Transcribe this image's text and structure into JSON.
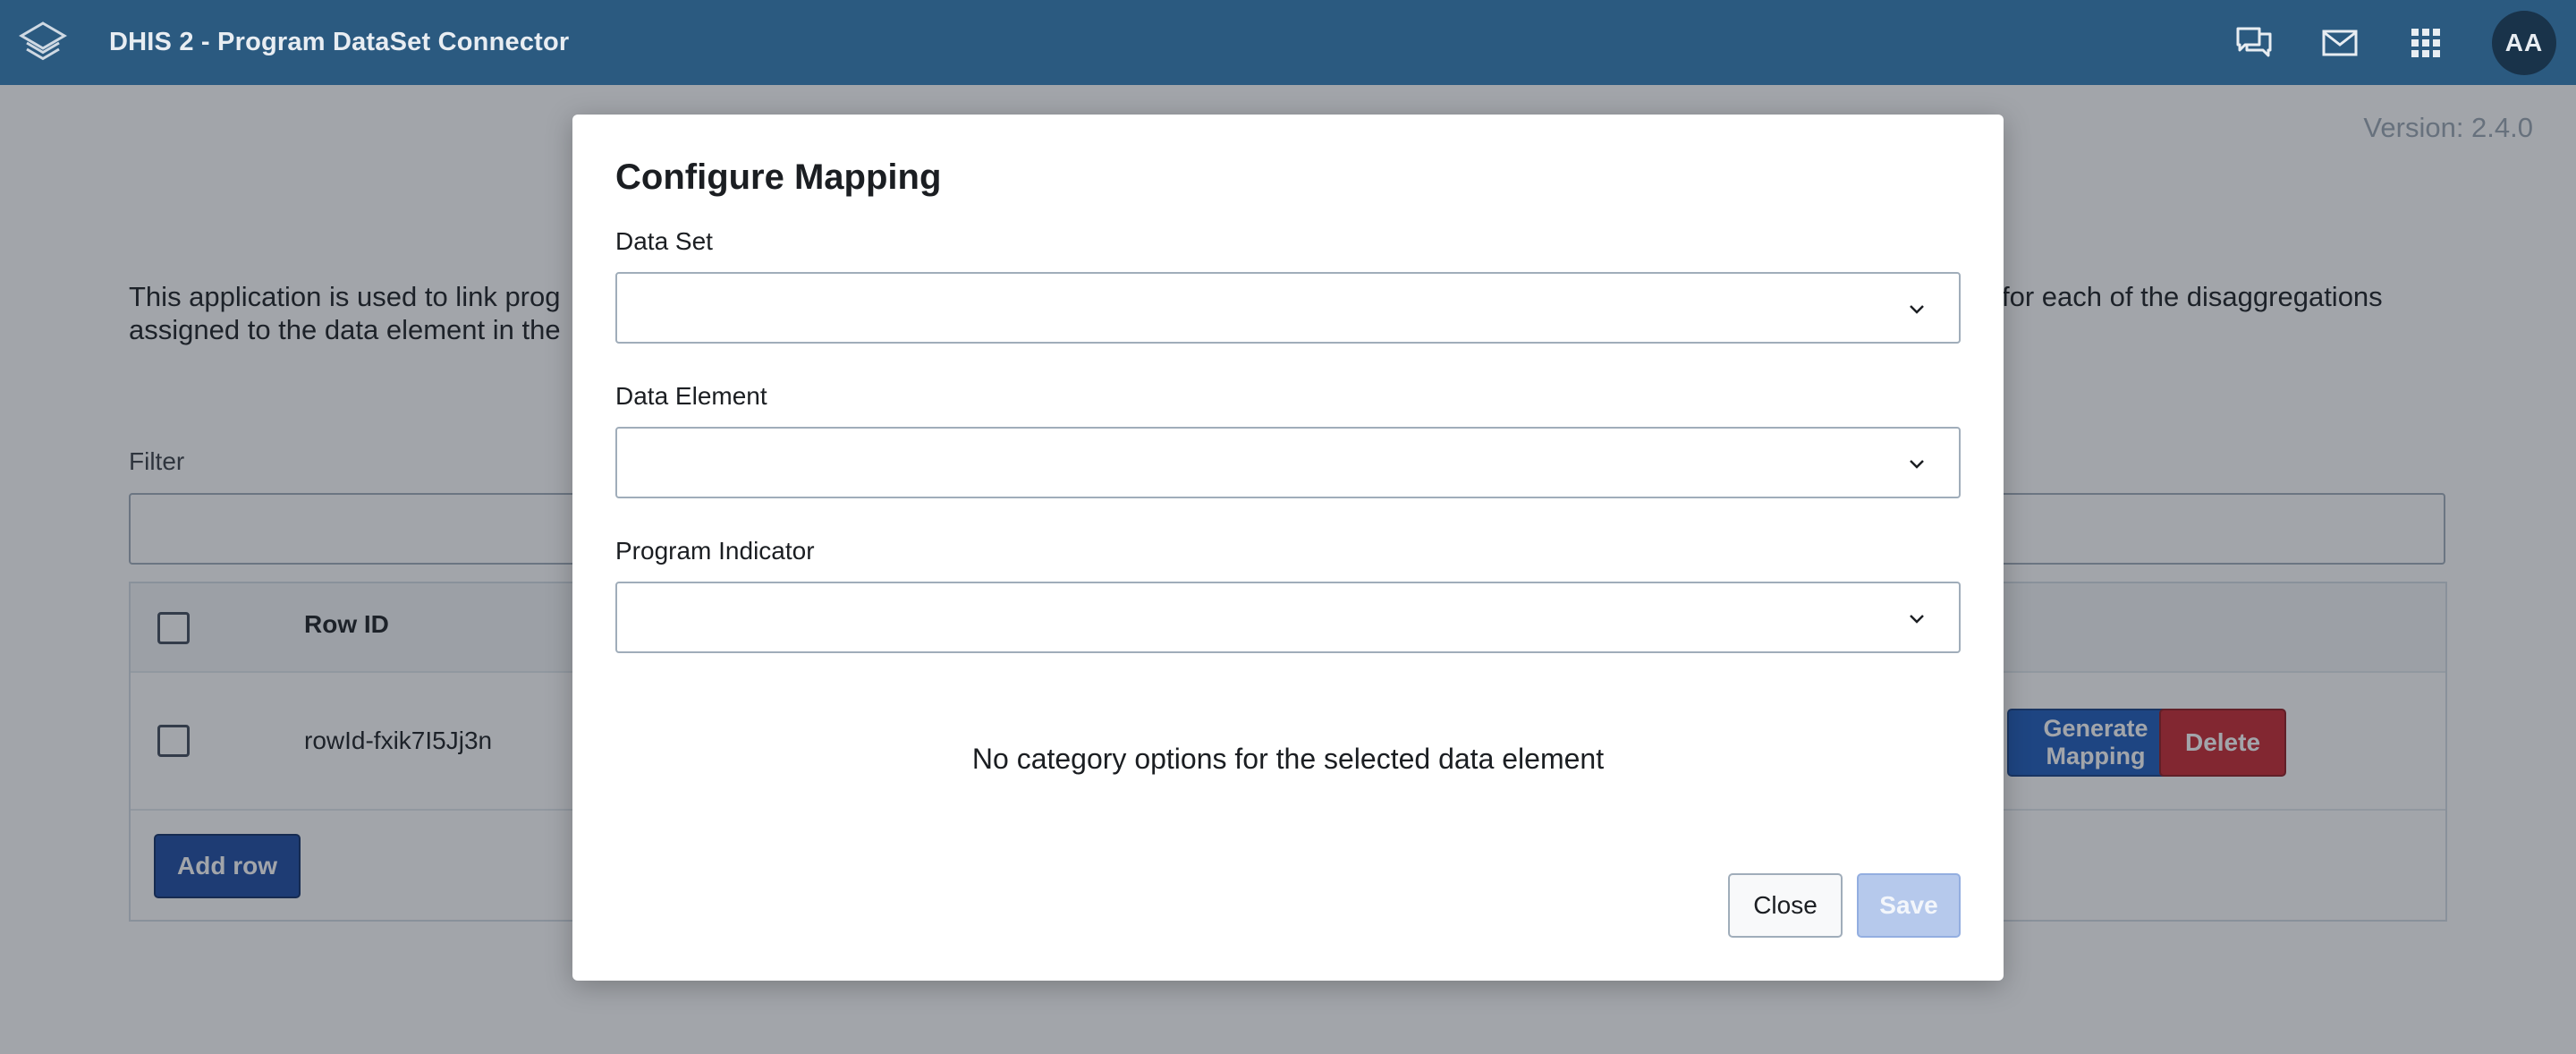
{
  "header": {
    "app_title": "DHIS 2 - Program DataSet Connector",
    "icons": [
      "apps-logo-icon",
      "chat-icon",
      "mail-icon",
      "app-grid-icon"
    ],
    "avatar_initials": "AA",
    "background_color": "#2b5a80"
  },
  "page": {
    "version": "Version: 2.4.0",
    "description": "This application is used to link prog                                                                                                                      for each of the disaggregations assigned to the data element in the",
    "description_visible_left_1": "This application is used to link prog",
    "description_visible_right_1": "for each of the disaggregations",
    "description_visible_left_2": "assigned to the data element in the",
    "filter_label": "Filter",
    "table": {
      "header_rowid": "Row ID",
      "rows": [
        {
          "row_id": "rowId-fxik7I5Jj3n",
          "generate_label": "Generate Mapping",
          "delete_label": "Delete"
        }
      ],
      "add_row_label": "Add row"
    }
  },
  "modal": {
    "title": "Configure Mapping",
    "fields": [
      {
        "label": "Data Set",
        "value": ""
      },
      {
        "label": "Data Element",
        "value": ""
      },
      {
        "label": "Program Indicator",
        "value": ""
      }
    ],
    "message": "No category options for the selected data element",
    "close_label": "Close",
    "save_label": "Save"
  },
  "colors": {
    "primary": "#1d5abb",
    "danger": "#c9262f",
    "save_disabled": "#b6c9ec"
  }
}
